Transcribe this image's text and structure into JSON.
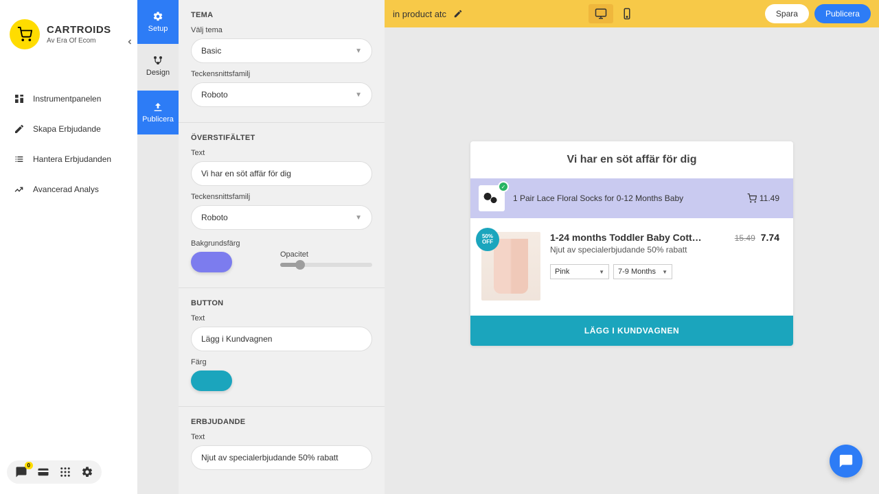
{
  "brand": {
    "name": "CARTROIDS",
    "subtitle": "Av Era Of Ecom"
  },
  "nav": {
    "dashboard": "Instrumentpanelen",
    "create": "Skapa Erbjudande",
    "manage": "Hantera Erbjudanden",
    "analytics": "Avancerad Analys"
  },
  "vtabs": {
    "setup": "Setup",
    "design": "Design",
    "publish": "Publicera"
  },
  "sections": {
    "tema": {
      "title": "TEMA",
      "choose": "Välj tema",
      "theme_value": "Basic",
      "font_label": "Teckensnittsfamilj",
      "font_value": "Roboto"
    },
    "overst": {
      "title": "ÖVERSTIFÄLTET",
      "text_label": "Text",
      "text_value": "Vi har en söt affär för dig",
      "font_label": "Teckensnittsfamilj",
      "font_value": "Roboto",
      "bg_label": "Bakgrundsfärg",
      "opacity_label": "Opacitet"
    },
    "button": {
      "title": "BUTTON",
      "text_label": "Text",
      "text_value": "Lägg i Kundvagnen",
      "color_label": "Färg"
    },
    "erbjudande": {
      "title": "ERBJUDANDE",
      "text_label": "Text",
      "text_value": "Njut av specialerbjudande 50% rabatt"
    }
  },
  "topbar": {
    "title": "in product atc",
    "save": "Spara",
    "publish": "Publicera"
  },
  "preview": {
    "headline": "Vi har en söt affär för dig",
    "cart_item": {
      "name": "1 Pair Lace Floral Socks for 0-12 Months Baby",
      "price": "11.49"
    },
    "offer": {
      "badge_line1": "50%",
      "badge_line2": "OFF",
      "name": "1-24 months Toddler Baby Cott…",
      "desc": "Njut av specialerbjudande 50% rabatt",
      "old_price": "15.49",
      "new_price": "7.74",
      "variant1": "Pink",
      "variant2": "7-9 Months"
    },
    "atc": "LÄGG I KUNDVAGNEN"
  },
  "bottom_badge": "0"
}
